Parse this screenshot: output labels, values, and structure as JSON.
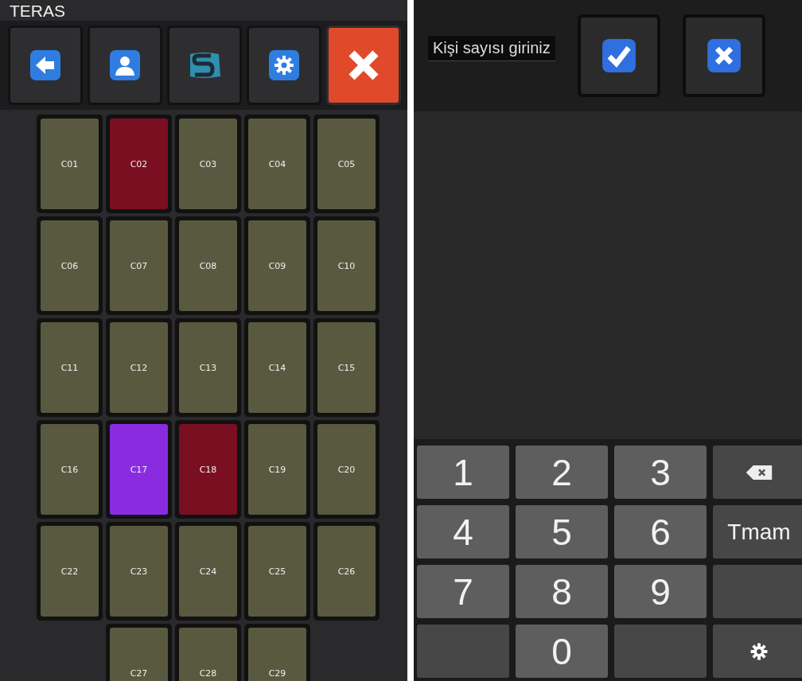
{
  "title": "TERAS",
  "toolbar": [
    {
      "kind": "back"
    },
    {
      "kind": "person"
    },
    {
      "kind": "logo"
    },
    {
      "kind": "settings"
    },
    {
      "kind": "close"
    }
  ],
  "tables": [
    {
      "label": "C01",
      "color": "#58593f"
    },
    {
      "label": "C02",
      "color": "#7a0f22"
    },
    {
      "label": "C03",
      "color": "#58593f"
    },
    {
      "label": "C04",
      "color": "#58593f"
    },
    {
      "label": "C05",
      "color": "#58593f"
    },
    {
      "label": "C06",
      "color": "#58593f"
    },
    {
      "label": "C07",
      "color": "#58593f"
    },
    {
      "label": "C08",
      "color": "#58593f"
    },
    {
      "label": "C09",
      "color": "#58593f"
    },
    {
      "label": "C10",
      "color": "#58593f"
    },
    {
      "label": "C11",
      "color": "#58593f"
    },
    {
      "label": "C12",
      "color": "#58593f"
    },
    {
      "label": "C13",
      "color": "#58593f"
    },
    {
      "label": "C14",
      "color": "#58593f"
    },
    {
      "label": "C15",
      "color": "#58593f"
    },
    {
      "label": "C16",
      "color": "#58593f"
    },
    {
      "label": "C17",
      "color": "#8a2be2"
    },
    {
      "label": "C18",
      "color": "#7a0f22"
    },
    {
      "label": "C19",
      "color": "#58593f"
    },
    {
      "label": "C20",
      "color": "#58593f"
    },
    {
      "label": "C22",
      "color": "#58593f"
    },
    {
      "label": "C23",
      "color": "#58593f"
    },
    {
      "label": "C24",
      "color": "#58593f"
    },
    {
      "label": "C25",
      "color": "#58593f"
    },
    {
      "label": "C26",
      "color": "#58593f"
    },
    {
      "kind": "gap"
    },
    {
      "label": "C27",
      "color": "#58593f"
    },
    {
      "label": "C28",
      "color": "#58593f"
    },
    {
      "label": "C29",
      "color": "#58593f"
    }
  ],
  "dialog": {
    "prompt": "Kişi sayısı giriniz",
    "buttons": [
      {
        "kind": "confirm"
      },
      {
        "kind": "cancel"
      }
    ]
  },
  "keypad": [
    {
      "kind": "digit",
      "label": "1"
    },
    {
      "kind": "digit",
      "label": "2"
    },
    {
      "kind": "digit",
      "label": "3"
    },
    {
      "kind": "backspace"
    },
    {
      "kind": "digit",
      "label": "4"
    },
    {
      "kind": "digit",
      "label": "5"
    },
    {
      "kind": "digit",
      "label": "6"
    },
    {
      "kind": "done",
      "label": "Tmam"
    },
    {
      "kind": "digit",
      "label": "7"
    },
    {
      "kind": "digit",
      "label": "8"
    },
    {
      "kind": "digit",
      "label": "9"
    },
    {
      "kind": "blank"
    },
    {
      "kind": "blank"
    },
    {
      "kind": "digit",
      "label": "0"
    },
    {
      "kind": "blank"
    },
    {
      "kind": "settings"
    }
  ]
}
